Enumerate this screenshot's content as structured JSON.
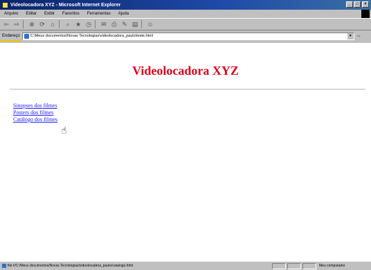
{
  "window": {
    "title": "Videolocadora XYZ - Microsoft Internet Explorer"
  },
  "menubar": {
    "items": [
      "Arquivo",
      "Editar",
      "Exibir",
      "Favoritos",
      "Ferramentas",
      "Ajuda"
    ]
  },
  "addressbar": {
    "label": "Endereço",
    "url": "C:\\Meus documentos\\Novas Tecnologias\\videolocadora_paulo\\teste.html"
  },
  "page": {
    "title": "Videolocadora XYZ",
    "links": [
      "Sinopses dos filmes",
      "Posters dos filmes",
      "Catálogo dos filmes"
    ]
  },
  "statusbar": {
    "text": "file:///C:/Meus documentos/Novas Tecnologias/videolocadora_paulo/catalogo.html",
    "zone": "Meu computador"
  },
  "colors": {
    "title_red": "#e0001a",
    "link_blue": "#1a1aff",
    "titlebar_blue": "#0a246a",
    "accent_yellow": "#f2c200"
  }
}
